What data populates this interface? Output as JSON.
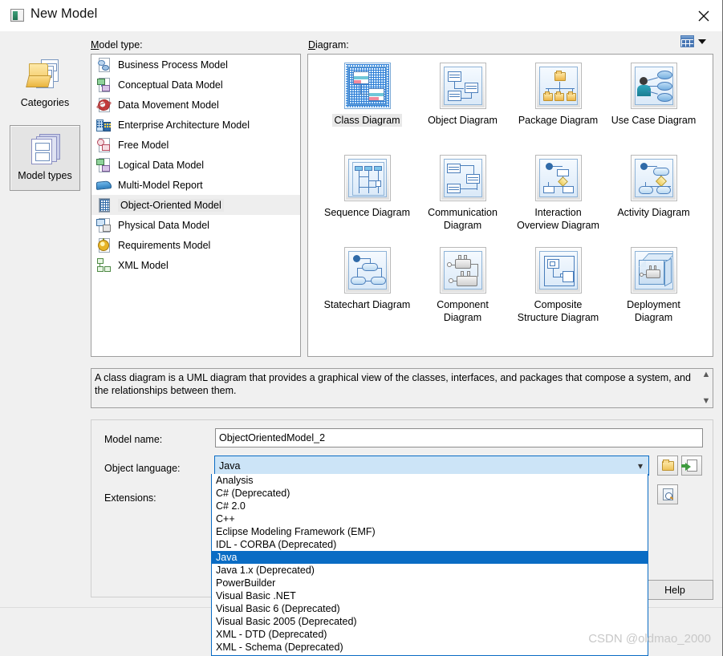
{
  "window": {
    "title": "New Model",
    "icon": "model-window-icon",
    "close_icon": "close-icon"
  },
  "toolbar": {
    "view_toggle_icon": "grid-view-icon",
    "view_toggle_dropdown_icon": "chevron-down-icon"
  },
  "labels": {
    "model_type": "Model type:",
    "diagram": "Diagram:"
  },
  "sidebar": {
    "items": [
      {
        "label": "Categories",
        "icon": "folder-pages-icon",
        "selected": false
      },
      {
        "label": "Model types",
        "icon": "stacked-models-icon",
        "selected": true
      }
    ]
  },
  "model_types": {
    "selected": "Object-Oriented Model",
    "items": [
      {
        "label": "Business Process Model",
        "icon": "business-process-icon"
      },
      {
        "label": "Conceptual Data Model",
        "icon": "conceptual-data-icon"
      },
      {
        "label": "Data Movement Model",
        "icon": "data-movement-icon"
      },
      {
        "label": "Enterprise Architecture Model",
        "icon": "enterprise-architecture-icon"
      },
      {
        "label": "Free Model",
        "icon": "free-model-icon"
      },
      {
        "label": "Logical Data Model",
        "icon": "logical-data-icon"
      },
      {
        "label": "Multi-Model Report",
        "icon": "multi-model-report-icon"
      },
      {
        "label": "Object-Oriented Model",
        "icon": "object-oriented-icon"
      },
      {
        "label": "Physical Data Model",
        "icon": "physical-data-icon"
      },
      {
        "label": "Requirements Model",
        "icon": "requirements-icon"
      },
      {
        "label": "XML Model",
        "icon": "xml-model-icon"
      }
    ]
  },
  "diagrams": {
    "selected": "Class Diagram",
    "items": [
      {
        "label": "Class Diagram",
        "icon": "class-diagram-icon"
      },
      {
        "label": "Object Diagram",
        "icon": "object-diagram-icon"
      },
      {
        "label": "Package Diagram",
        "icon": "package-diagram-icon"
      },
      {
        "label": "Use Case Diagram",
        "icon": "use-case-diagram-icon"
      },
      {
        "label": "Sequence Diagram",
        "icon": "sequence-diagram-icon"
      },
      {
        "label": "Communication Diagram",
        "icon": "communication-diagram-icon"
      },
      {
        "label": "Interaction Overview Diagram",
        "icon": "interaction-overview-diagram-icon"
      },
      {
        "label": "Activity Diagram",
        "icon": "activity-diagram-icon"
      },
      {
        "label": "Statechart Diagram",
        "icon": "statechart-diagram-icon"
      },
      {
        "label": "Component Diagram",
        "icon": "component-diagram-icon"
      },
      {
        "label": "Composite Structure Diagram",
        "icon": "composite-structure-diagram-icon"
      },
      {
        "label": "Deployment Diagram",
        "icon": "deployment-diagram-icon"
      }
    ]
  },
  "description": {
    "text": "A class diagram is a UML diagram that provides a graphical view of the classes, interfaces, and packages that compose a system, and the relationships between them.",
    "scroll_up_icon": "chevron-up-icon",
    "scroll_down_icon": "chevron-down-icon"
  },
  "form": {
    "model_name_label": "Model name:",
    "model_name_value": "ObjectOrientedModel_2",
    "object_language_label": "Object language:",
    "object_language_value": "Java",
    "object_language_arrow_icon": "chevron-down-icon",
    "extensions_label": "Extensions:",
    "buttons": [
      {
        "name": "browse-folder-button",
        "icon": "folder-icon"
      },
      {
        "name": "import-language-button",
        "icon": "page-import-icon"
      },
      {
        "name": "language-properties-button",
        "icon": "page-preview-icon"
      }
    ]
  },
  "object_language_dropdown": {
    "selected": "Java",
    "options": [
      "Analysis",
      "C# (Deprecated)",
      "C# 2.0",
      "C++",
      "Eclipse Modeling Framework (EMF)",
      "IDL - CORBA (Deprecated)",
      "Java",
      "Java 1.x (Deprecated)",
      "PowerBuilder",
      "Visual Basic .NET",
      "Visual Basic 6 (Deprecated)",
      "Visual Basic 2005 (Deprecated)",
      "XML - DTD (Deprecated)",
      "XML - Schema (Deprecated)"
    ]
  },
  "footer": {
    "help_label": "Help"
  },
  "watermark": {
    "text": "CSDN @oldmao_2000"
  }
}
